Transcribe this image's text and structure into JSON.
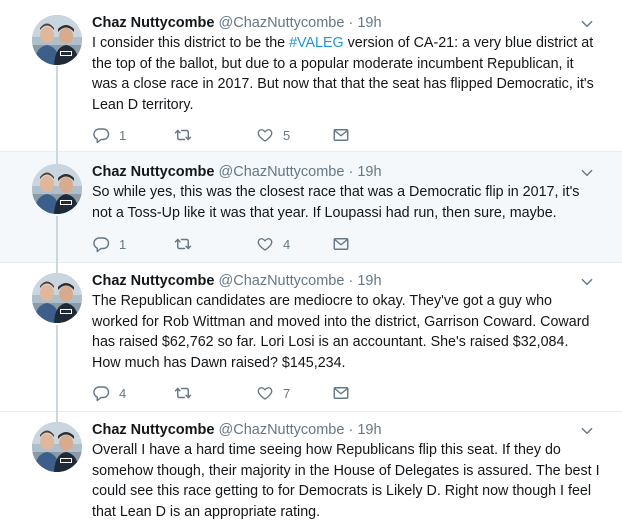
{
  "icons": {
    "reply": "reply-icon",
    "retweet": "retweet-icon",
    "like": "heart-icon",
    "dm": "envelope-icon",
    "caret": "chevron-down-icon"
  },
  "colors": {
    "text": "#14171a",
    "muted": "#657786",
    "link": "#1b95e0",
    "highlight_bg": "#f5f8fa",
    "divider": "#e6ecf0"
  },
  "tweets": [
    {
      "name": "Chaz Nuttycombe",
      "handle": "@ChazNuttycombe",
      "dot": "·",
      "time": "19h",
      "text_before": "I consider this district to be the ",
      "hashtag": "#VALEG",
      "text_after": " version of CA-21: a very blue district at the top of the ballot, but due to a popular moderate incumbent Republican, it was a close race in 2017. But now that that the seat has flipped Democratic, it's Lean D territory.",
      "replies": "1",
      "retweets": "",
      "likes": "5"
    },
    {
      "name": "Chaz Nuttycombe",
      "handle": "@ChazNuttycombe",
      "dot": "·",
      "time": "19h",
      "text": "So while yes, this was the closest race that was a Democratic flip in 2017, it's not a Toss-Up like it was that year. If Loupassi had run, then sure, maybe.",
      "replies": "1",
      "retweets": "",
      "likes": "4"
    },
    {
      "name": "Chaz Nuttycombe",
      "handle": "@ChazNuttycombe",
      "dot": "·",
      "time": "19h",
      "text": "The Republican candidates are mediocre to okay. They've got a guy who worked for Rob Wittman and moved into the district, Garrison Coward. Coward has raised $62,762 so far. Lori Losi is an accountant. She's raised $32,084. How much has Dawn raised? $145,234.",
      "replies": "4",
      "retweets": "",
      "likes": "7"
    },
    {
      "name": "Chaz Nuttycombe",
      "handle": "@ChazNuttycombe",
      "dot": "·",
      "time": "19h",
      "text": "Overall I have a hard time seeing how Republicans flip this seat. If they do somehow though, their majority in the House of Delegates is assured. The best I could see this race getting to for Democrats is Likely D. Right now though I feel that Lean D is an appropriate rating."
    }
  ]
}
